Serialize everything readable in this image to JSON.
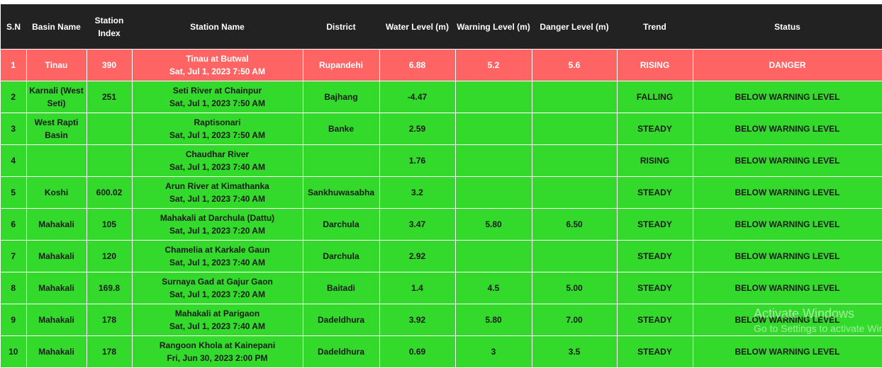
{
  "headers": [
    "S.N",
    "Basin Name",
    "Station Index",
    "Station Name",
    "District",
    "Water Level (m)",
    "Warning Level (m)",
    "Danger Level (m)",
    "Trend",
    "Status"
  ],
  "rows": [
    {
      "sn": "1",
      "basin": "Tinau",
      "index": "390",
      "station": "Tinau at Butwal",
      "datetime": "Sat, Jul 1, 2023 7:50 AM",
      "district": "Rupandehi",
      "water": "6.88",
      "warning": "5.2",
      "danger": "5.6",
      "trend": "RISING",
      "status": "DANGER",
      "state": "danger"
    },
    {
      "sn": "2",
      "basin": "Karnali (West Seti)",
      "index": "251",
      "station": "Seti River at Chainpur",
      "datetime": "Sat, Jul 1, 2023 7:50 AM",
      "district": "Bajhang",
      "water": "-4.47",
      "warning": "",
      "danger": "",
      "trend": "FALLING",
      "status": "BELOW WARNING LEVEL",
      "state": "normal"
    },
    {
      "sn": "3",
      "basin": "West Rapti Basin",
      "index": "",
      "station": "Raptisonari",
      "datetime": "Sat, Jul 1, 2023 7:50 AM",
      "district": "Banke",
      "water": "2.59",
      "warning": "",
      "danger": "",
      "trend": "STEADY",
      "status": "BELOW WARNING LEVEL",
      "state": "normal"
    },
    {
      "sn": "4",
      "basin": "",
      "index": "",
      "station": "Chaudhar River",
      "datetime": "Sat, Jul 1, 2023 7:40 AM",
      "district": "",
      "water": "1.76",
      "warning": "",
      "danger": "",
      "trend": "RISING",
      "status": "BELOW WARNING LEVEL",
      "state": "normal"
    },
    {
      "sn": "5",
      "basin": "Koshi",
      "index": "600.02",
      "station": "Arun River at Kimathanka",
      "datetime": "Sat, Jul 1, 2023 7:40 AM",
      "district": "Sankhuwasabha",
      "water": "3.2",
      "warning": "",
      "danger": "",
      "trend": "STEADY",
      "status": "BELOW WARNING LEVEL",
      "state": "normal"
    },
    {
      "sn": "6",
      "basin": "Mahakali",
      "index": "105",
      "station": "Mahakali at Darchula (Dattu)",
      "datetime": "Sat, Jul 1, 2023 7:20 AM",
      "district": "Darchula",
      "water": "3.47",
      "warning": "5.80",
      "danger": "6.50",
      "trend": "STEADY",
      "status": "BELOW WARNING LEVEL",
      "state": "normal"
    },
    {
      "sn": "7",
      "basin": "Mahakali",
      "index": "120",
      "station": "Chamelia at Karkale Gaun",
      "datetime": "Sat, Jul 1, 2023 7:40 AM",
      "district": "Darchula",
      "water": "2.92",
      "warning": "",
      "danger": "",
      "trend": "STEADY",
      "status": "BELOW WARNING LEVEL",
      "state": "normal"
    },
    {
      "sn": "8",
      "basin": "Mahakali",
      "index": "169.8",
      "station": "Surnaya Gad at Gajur Gaon",
      "datetime": "Sat, Jul 1, 2023 7:20 AM",
      "district": "Baitadi",
      "water": "1.4",
      "warning": "4.5",
      "danger": "5.00",
      "trend": "STEADY",
      "status": "BELOW WARNING LEVEL",
      "state": "normal"
    },
    {
      "sn": "9",
      "basin": "Mahakali",
      "index": "178",
      "station": "Mahakali at Parigaon",
      "datetime": "Sat, Jul 1, 2023 7:40 AM",
      "district": "Dadeldhura",
      "water": "3.92",
      "warning": "5.80",
      "danger": "7.00",
      "trend": "STEADY",
      "status": "BELOW WARNING LEVEL",
      "state": "normal"
    },
    {
      "sn": "10",
      "basin": "Mahakali",
      "index": "178",
      "station": "Rangoon Khola at Kainepani",
      "datetime": "Fri, Jun 30, 2023 2:00 PM",
      "district": "Dadeldhura",
      "water": "0.69",
      "warning": "3",
      "danger": "3.5",
      "trend": "STEADY",
      "status": "BELOW WARNING LEVEL",
      "state": "normal"
    }
  ],
  "colors": {
    "header_bg": "#222222",
    "danger_row": "#fe6464",
    "normal_row": "#33d92b"
  },
  "watermark": {
    "line1": "Activate Windows",
    "line2": "Go to Settings to activate Windows."
  }
}
